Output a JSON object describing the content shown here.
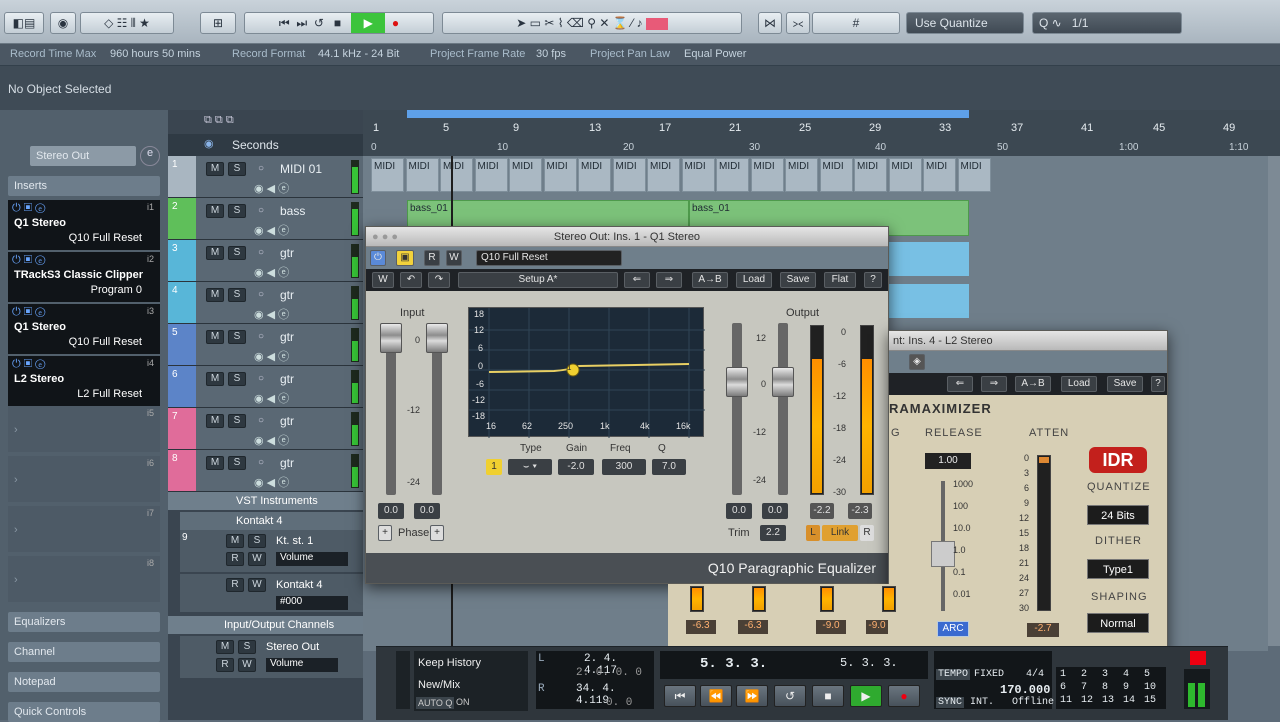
{
  "toolbar": {
    "quantize": "Use Quantize",
    "quantize_value": "1/1",
    "buttons": [
      "record-mode-icon",
      "automation-icon",
      "constrain-icon",
      "tool-icon",
      "mixer-icon",
      "star-icon",
      "grid-icon",
      "rewind-icon",
      "forward-icon",
      "cycle-icon",
      "stop-icon",
      "play-icon",
      "record-icon",
      "object-select-icon",
      "range-icon",
      "split-icon",
      "glue-icon",
      "erase-icon",
      "zoom-icon",
      "mute-icon",
      "time-warp-icon",
      "line-icon",
      "play-tool-icon",
      "color-icon",
      "snap-icon",
      "grid-type-icon",
      "q-icon"
    ]
  },
  "infobar": {
    "record_time_label": "Record Time Max",
    "record_time": "960 hours 50 mins",
    "record_format_label": "Record Format",
    "record_format": "44.1 kHz - 24 Bit",
    "frame_rate_label": "Project Frame Rate",
    "frame_rate": "30 fps",
    "pan_law_label": "Project Pan Law",
    "pan_law": "Equal Power"
  },
  "object": {
    "status": "No Object Selected"
  },
  "inspector": {
    "output": "Stereo Out",
    "inserts_label": "Inserts",
    "slots": [
      {
        "name": "Q1 Stereo",
        "preset": "Q10 Full Reset",
        "num": "i1"
      },
      {
        "name": "TRackS3 Classic Clipper",
        "preset": "Program 0",
        "num": "i2"
      },
      {
        "name": "Q1 Stereo",
        "preset": "Q10 Full Reset",
        "num": "i3"
      },
      {
        "name": "L2 Stereo",
        "preset": "L2 Full Reset",
        "num": "i4"
      }
    ],
    "empty_slots": [
      "i5",
      "i6",
      "i7",
      "i8"
    ],
    "sections": [
      "Equalizers",
      "Channel",
      "Notepad",
      "Quick Controls"
    ]
  },
  "tracks": {
    "header": "Seconds",
    "list": [
      {
        "num": "1",
        "name": "MIDI 01",
        "color": "#a9b6c1"
      },
      {
        "num": "2",
        "name": "bass",
        "color": "#5fbf5a"
      },
      {
        "num": "3",
        "name": "gtr",
        "color": "#58b6d8"
      },
      {
        "num": "4",
        "name": "gtr",
        "color": "#58b6d8"
      },
      {
        "num": "5",
        "name": "gtr",
        "color": "#5c84c8"
      },
      {
        "num": "6",
        "name": "gtr",
        "color": "#5c84c8"
      },
      {
        "num": "7",
        "name": "gtr",
        "color": "#e06c9a"
      },
      {
        "num": "8",
        "name": "gtr",
        "color": "#e06c9a"
      }
    ],
    "folder_vst": "VST Instruments",
    "kontakt": "Kontakt 4",
    "kt_track": "Kt. st. 1",
    "kt_param": "Volume",
    "kontakt_inst": "Kontakt 4",
    "kontakt_inst_param": "#000",
    "io_folder": "Input/Output Channels",
    "stereo_out": "Stereo Out",
    "stereo_out_param": "Volume",
    "m": "M",
    "s": "S",
    "r": "R",
    "w": "W"
  },
  "ruler": {
    "bars": [
      "1",
      "5",
      "9",
      "13",
      "17",
      "21",
      "25",
      "29",
      "33",
      "37",
      "41",
      "45",
      "49"
    ],
    "seconds": [
      "0",
      "10",
      "20",
      "30",
      "40",
      "50",
      "1:00",
      "1:10"
    ]
  },
  "events": {
    "midi": "MIDI",
    "bass1": "bass_01",
    "bass2": "bass_01"
  },
  "q10": {
    "window_title": "Stereo Out: Ins. 1 - Q1 Stereo",
    "preset": "Q10 Full Reset",
    "setup": "Setup A*",
    "ab": "A→B",
    "load": "Load",
    "save": "Save",
    "flat": "Flat",
    "help": "?",
    "input_label": "Input",
    "output_label": "Output",
    "in_vals": [
      "0.0",
      "0.0"
    ],
    "out_vals": [
      "0.0",
      "0.0"
    ],
    "peak_vals": [
      "-2.2",
      "-2.3"
    ],
    "phase": "Phase",
    "trim_label": "Trim",
    "trim": "2.2",
    "link": "Link",
    "l": "L",
    "r": "R",
    "db_scale": [
      "18",
      "12",
      "6",
      "0",
      "-6",
      "-12",
      "-18"
    ],
    "freq_scale": [
      "16",
      "62",
      "250",
      "1k",
      "4k",
      "16k"
    ],
    "fader_scale": [
      "0",
      "-12",
      "-24"
    ],
    "out_scale": [
      "12",
      "0",
      "-12",
      "-24"
    ],
    "meter_scale": [
      "0",
      "-6",
      "-12",
      "-18",
      "-24",
      "-30"
    ],
    "band_label": "1",
    "type_label": "Type",
    "gain_label": "Gain",
    "freq_label": "Freq",
    "q_label": "Q",
    "gain": "-2.0",
    "freq": "300",
    "q": "7.0",
    "name": "Q10 Paragraphic Equalizer",
    "accent": "#f0d030"
  },
  "l2": {
    "window_title": "nt: Ins. 4 - L2 Stereo",
    "ab": "A→B",
    "load": "Load",
    "save": "Save",
    "help": "?",
    "brand": "RAMAXIMIZER",
    "release_label": "RELEASE",
    "release": "1.00",
    "release_scale": [
      "1000",
      "100",
      "10.0",
      "1.0",
      "0.1",
      "0.01"
    ],
    "atten_label": "ATTEN",
    "atten_scale": [
      "0",
      "3",
      "6",
      "9",
      "12",
      "15",
      "18",
      "21",
      "24",
      "27",
      "30"
    ],
    "arc": "ARC",
    "atten_val": "-2.7",
    "idr": "IDR",
    "quantize_label": "QUANTIZE",
    "quantize": "24 Bits",
    "dither_label": "DITHER",
    "dither": "Type1",
    "shaping_label": "SHAPING",
    "shaping": "Normal",
    "left_vals": [
      "-6.3",
      "-6.3",
      "-9.0",
      "-9.0"
    ],
    "letter": "G"
  },
  "transport": {
    "keep_history": "Keep History",
    "new_mix": "New/Mix",
    "auto_q": "AUTO Q",
    "on": "ON",
    "l": "L",
    "r": "R",
    "left_loc": "2. 4. 4.117",
    "left_loc2": "2. 0. 0. 0",
    "right_loc": "34. 4. 4.119",
    "right_loc2": "0. 0",
    "primary": "5. 3. 3.",
    "primary2": "5. 3. 3.",
    "tempo_label": "TEMPO",
    "tempo_mode": "FIXED",
    "sig": "4/4",
    "tempo": "170.000",
    "sync_label": "SYNC",
    "sync": "INT.",
    "offline": "Offline",
    "markers": [
      "1",
      "2",
      "3",
      "4",
      "5",
      "6",
      "7",
      "8",
      "9",
      "10",
      "11",
      "12",
      "13",
      "14",
      "15"
    ]
  }
}
